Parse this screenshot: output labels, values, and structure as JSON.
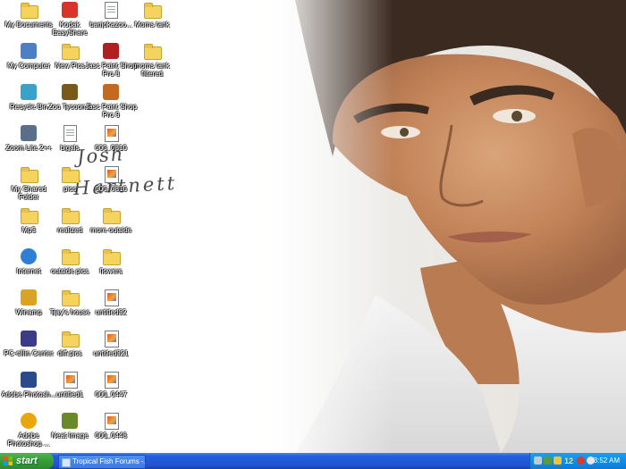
{
  "desktop": {
    "icons": [
      {
        "label": "My Documents",
        "icon": "my-documents-icon",
        "type": "folder-doc"
      },
      {
        "label": "Kodak EasyShare",
        "icon": "kodak-easyshare-icon",
        "type": "app-red"
      },
      {
        "label": "banjokazoo...",
        "icon": "document-icon",
        "type": "doc"
      },
      {
        "label": "Moms tank",
        "icon": "folder-icon",
        "type": "folder"
      },
      {
        "label": "My Computer",
        "icon": "my-computer-icon",
        "type": "computer"
      },
      {
        "label": "New Pics",
        "icon": "folder-icon",
        "type": "folder"
      },
      {
        "label": "Jasc Paint Shop Pro 8",
        "icon": "paint-shop-pro-icon",
        "type": "app-psp8"
      },
      {
        "label": "moms tank filtered",
        "icon": "folder-icon",
        "type": "folder"
      },
      {
        "label": "Recycle Bin",
        "icon": "recycle-bin-icon",
        "type": "recycle"
      },
      {
        "label": "Zoo Tycoon 2",
        "icon": "zoo-tycoon-icon",
        "type": "app-zoo"
      },
      {
        "label": "Jasc Paint Shop Pro 9",
        "icon": "paint-shop-pro-icon",
        "type": "app-psp9"
      },
      {
        "label": "Zoom Lite 2++",
        "icon": "zoom-lite-icon",
        "type": "app-zoom"
      },
      {
        "label": "bigals",
        "icon": "document-icon",
        "type": "doc"
      },
      {
        "label": "000_0810",
        "icon": "image-file-icon",
        "type": "img"
      },
      {
        "label": "My Shared Folder",
        "icon": "shared-folder-icon",
        "type": "folder"
      },
      {
        "label": "pics",
        "icon": "folder-icon",
        "type": "folder"
      },
      {
        "label": "000_0810",
        "icon": "image-file-icon",
        "type": "img"
      },
      {
        "label": "Mp3",
        "icon": "folder-icon",
        "type": "folder"
      },
      {
        "label": "realized",
        "icon": "folder-icon",
        "type": "folder"
      },
      {
        "label": "more outside",
        "icon": "folder-icon",
        "type": "folder"
      },
      {
        "label": "Internet",
        "icon": "internet-explorer-icon",
        "type": "ie"
      },
      {
        "label": "outside pics",
        "icon": "folder-icon",
        "type": "folder"
      },
      {
        "label": "flowers",
        "icon": "folder-icon",
        "type": "folder"
      },
      {
        "label": "Winamp",
        "icon": "winamp-icon",
        "type": "app-winamp"
      },
      {
        "label": "Tjay's house",
        "icon": "folder-icon",
        "type": "folder"
      },
      {
        "label": "untitled32",
        "icon": "image-file-icon",
        "type": "img"
      },
      {
        "label": "PC-cillin Center",
        "icon": "pc-cillin-icon",
        "type": "app-pcc"
      },
      {
        "label": "diff pics",
        "icon": "folder-icon",
        "type": "folder"
      },
      {
        "label": "untitled321",
        "icon": "image-file-icon",
        "type": "img-blue"
      },
      {
        "label": "Adobe Photosh...",
        "icon": "adobe-photoshop-icon",
        "type": "app-ps"
      },
      {
        "label": "untitled1",
        "icon": "image-file-icon",
        "type": "img"
      },
      {
        "label": "000_0447",
        "icon": "image-file-icon",
        "type": "img"
      },
      {
        "label": "Adobe Photoshop ...",
        "icon": "adobe-photoshop-album-icon",
        "type": "app-sun"
      },
      {
        "label": "Neat Image",
        "icon": "neat-image-icon",
        "type": "app-neat"
      },
      {
        "label": "000_0448",
        "icon": "image-file-icon",
        "type": "img"
      }
    ],
    "watermark": {
      "line1": "Josh",
      "line2": "Hartnett"
    }
  },
  "taskbar": {
    "start_label": "start",
    "task_item_label": "Tropical Fish Forums -...",
    "tray_number": "12",
    "clock": "3:52 AM"
  },
  "colors": {
    "taskbar_blue": "#245edb",
    "start_green": "#379d37",
    "tray_blue": "#118ee8"
  }
}
